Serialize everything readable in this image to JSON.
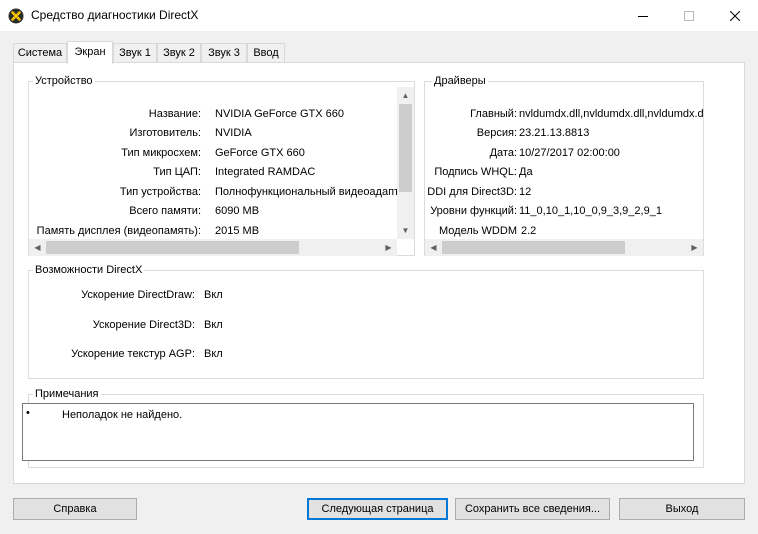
{
  "window": {
    "title": "Средство диагностики DirectX",
    "icon": "directx-x-icon"
  },
  "tabs": [
    {
      "label": "Система"
    },
    {
      "label": "Экран"
    },
    {
      "label": "Звук 1"
    },
    {
      "label": "Звук 2"
    },
    {
      "label": "Звук 3"
    },
    {
      "label": "Ввод"
    }
  ],
  "device": {
    "title": "Устройство",
    "rows": [
      {
        "label": "Название:",
        "value": "NVIDIA GeForce GTX 660"
      },
      {
        "label": "Изготовитель:",
        "value": "NVIDIA"
      },
      {
        "label": "Тип микросхем:",
        "value": "GeForce GTX 660"
      },
      {
        "label": "Тип ЦАП:",
        "value": "Integrated RAMDAC"
      },
      {
        "label": "Тип устройства:",
        "value": "Полнофункциональный видеоадапт"
      },
      {
        "label": "Всего памяти:",
        "value": "6090 MB"
      },
      {
        "label": "Память дисплея (видеопамять):",
        "value": "2015 MB"
      }
    ]
  },
  "drivers": {
    "title": "Драйверы",
    "rows": [
      {
        "label": "Главный:",
        "value": "nvldumdx.dll,nvldumdx.dll,nvldumdx.dl"
      },
      {
        "label": "Версия:",
        "value": "23.21.13.8813"
      },
      {
        "label": "Дата:",
        "value": "10/27/2017 02:00:00"
      },
      {
        "label": "Подпись WHQL:",
        "value": "Да"
      },
      {
        "label": "DDI для Direct3D:",
        "value": "12"
      },
      {
        "label": "Уровни функций:",
        "value": "11_0,10_1,10_0,9_3,9_2,9_1"
      },
      {
        "label": "Модель WDDM",
        "value": "2.2"
      }
    ]
  },
  "features": {
    "title": "Возможности DirectX",
    "rows": [
      {
        "label": "Ускорение DirectDraw:",
        "value": "Вкл"
      },
      {
        "label": "Ускорение Direct3D:",
        "value": "Вкл"
      },
      {
        "label": "Ускорение текстур AGP:",
        "value": "Вкл"
      }
    ]
  },
  "notes": {
    "title": "Примечания",
    "items": [
      "Неполадок не найдено."
    ]
  },
  "buttons": {
    "help": "Справка",
    "next": "Следующая страница",
    "save": "Сохранить все сведения...",
    "exit": "Выход"
  }
}
